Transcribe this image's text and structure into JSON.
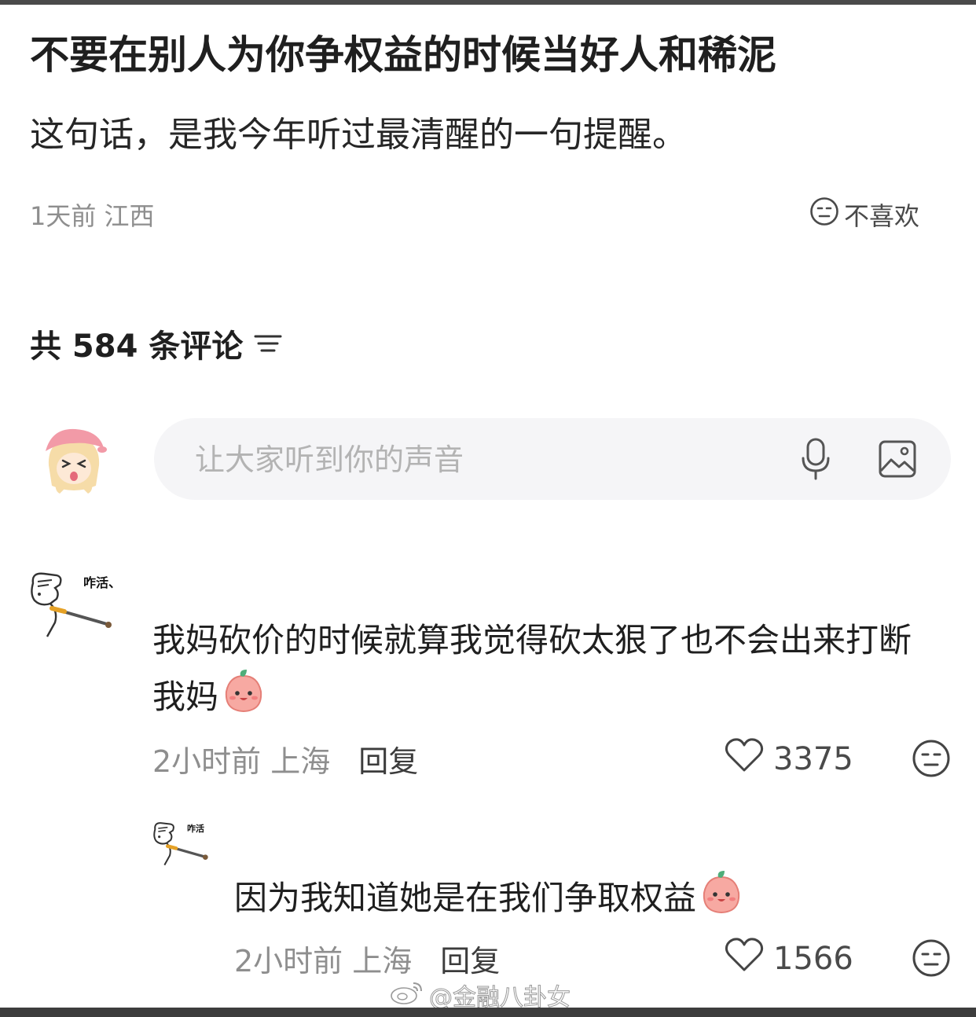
{
  "post": {
    "title": "不要在别人为你争权益的时候当好人和稀泥",
    "body": "这句话，是我今年听过最清醒的一句提醒。",
    "meta": "1天前 江西",
    "dislike_label": "不喜欢"
  },
  "comments_section": {
    "count_label": "共 584 条评论",
    "input_placeholder": "让大家听到你的声音",
    "icons": [
      "mic-icon",
      "image-icon",
      "sort-icon"
    ]
  },
  "comments": [
    {
      "avatar_caption": "咋活、",
      "text": "我妈砍价的时候就算我觉得砍太狠了也不会出来打断我妈",
      "time_location": "2小时前 上海",
      "reply_label": "回复",
      "likes": "3375"
    },
    {
      "avatar_caption": "咋活",
      "text": "因为我知道她是在我们争取权益",
      "time_location": "2小时前 上海",
      "reply_label": "回复",
      "likes": "1566"
    }
  ],
  "watermark": {
    "text": "@金融八卦女"
  },
  "colors": {
    "background": "#ffffff",
    "input_background": "#f5f5f7",
    "secondary_text": "#8e8e8e",
    "top_bar": "#4a4a4a"
  }
}
